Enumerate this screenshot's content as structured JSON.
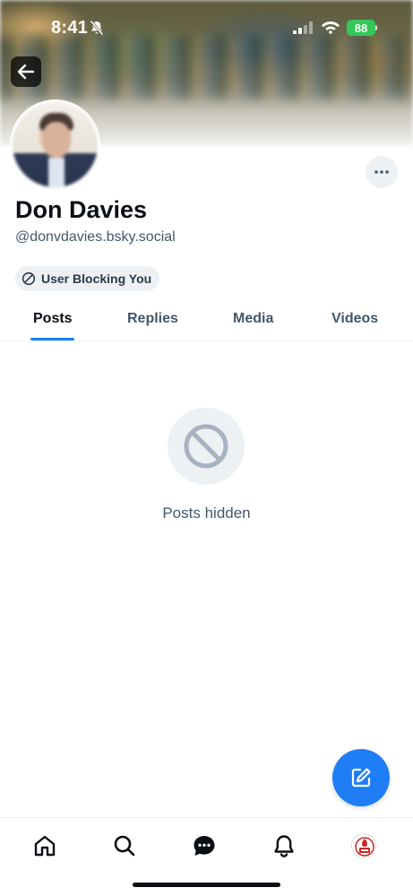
{
  "status_bar": {
    "time": "8:41",
    "battery": "88",
    "icons": [
      "bell-slash-icon",
      "cellular-signal-icon",
      "wifi-icon",
      "battery-charging-icon"
    ]
  },
  "profile": {
    "display_name": "Don Davies",
    "handle": "@donvdavies.bsky.social",
    "badge_label": "User Blocking You"
  },
  "tabs": [
    {
      "label": "Posts",
      "active": true
    },
    {
      "label": "Replies",
      "active": false
    },
    {
      "label": "Media",
      "active": false
    },
    {
      "label": "Videos",
      "active": false
    }
  ],
  "empty_state": {
    "icon": "prohibited-icon",
    "message": "Posts hidden"
  },
  "bottom_nav": {
    "items": [
      "home-icon",
      "search-icon",
      "chat-icon",
      "notifications-icon",
      "profile-avatar"
    ]
  },
  "colors": {
    "accent": "#1083fe",
    "fab": "#1f7ef5",
    "battery": "#34c759",
    "muted_text": "#42576c",
    "pill_bg": "#eef1f4"
  }
}
